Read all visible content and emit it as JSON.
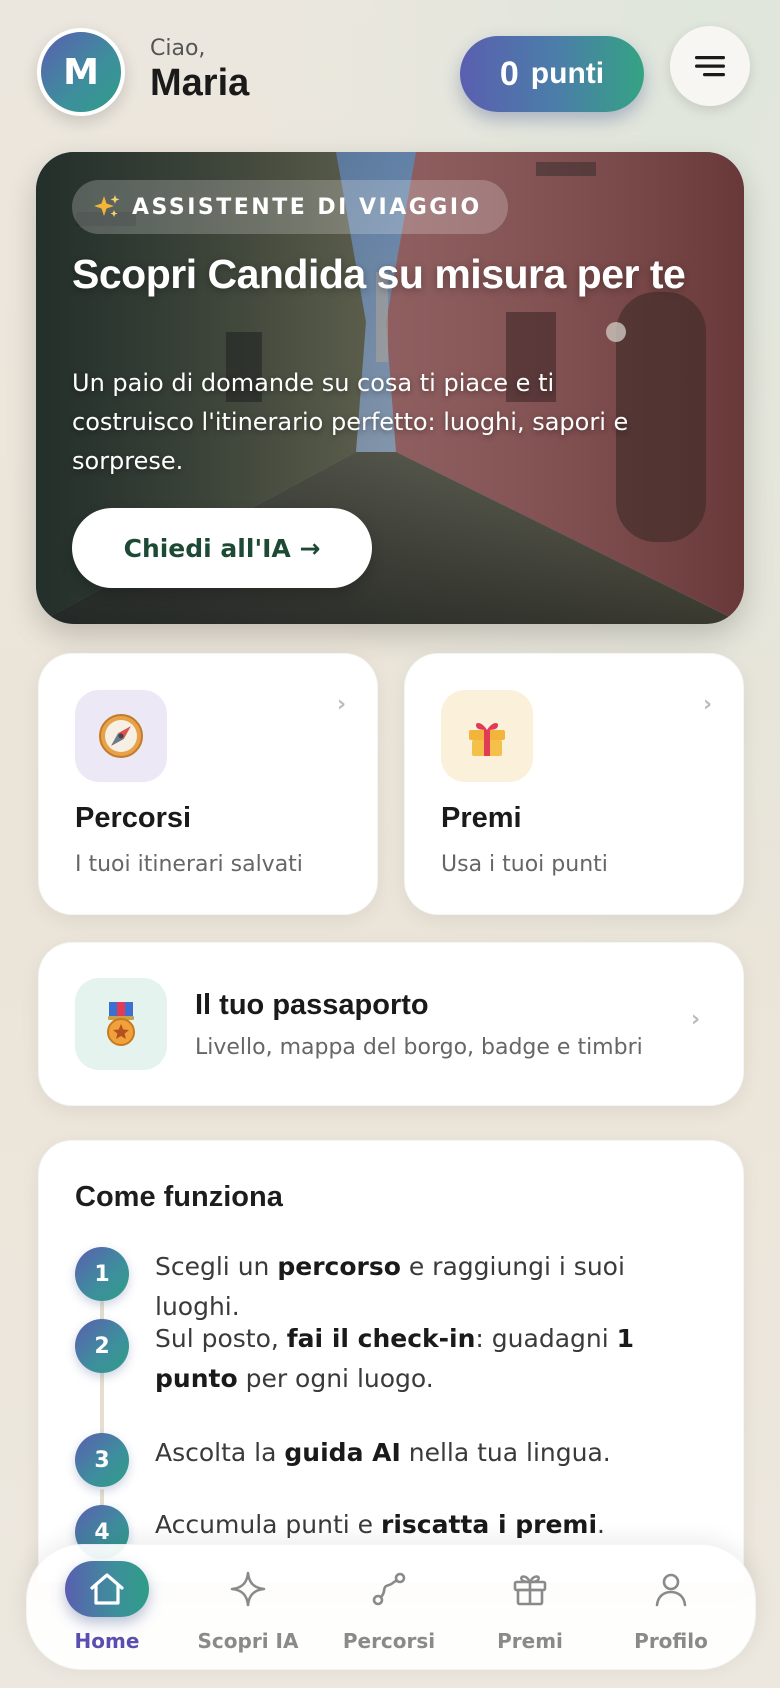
{
  "header": {
    "avatar_initial": "M",
    "greeting": "Ciao,",
    "user_name": "Maria",
    "points_value": "0",
    "points_label": "punti",
    "menu_icon": "hamburger-icon"
  },
  "hero": {
    "badge_icon": "sparkles-icon",
    "badge_label": "ASSISTENTE DI VIAGGIO",
    "title": "Scopri Candida su misura per te",
    "description": "Un paio di domande su cosa ti piace e ti costruisco l'itinerario perfetto: luoghi, sapori e sorprese.",
    "cta_label": "Chiedi all'IA →"
  },
  "cards": {
    "percorsi": {
      "icon": "compass-icon",
      "title": "Percorsi",
      "subtitle": "I tuoi itinerari salvati"
    },
    "premi": {
      "icon": "gift-icon",
      "title": "Premi",
      "subtitle": "Usa i tuoi punti"
    },
    "passaporto": {
      "icon": "medal-icon",
      "title": "Il tuo passaporto",
      "subtitle": "Livello, mappa del borgo, badge e timbri"
    }
  },
  "how_it_works": {
    "title": "Come funziona",
    "steps": [
      {
        "num": "1",
        "pre": "Scegli un ",
        "b1": "percorso",
        "mid": " e raggiungi i suoi luoghi.",
        "b2": "",
        "post": ""
      },
      {
        "num": "2",
        "pre": "Sul posto, ",
        "b1": "fai il check-in",
        "mid": ": guadagni ",
        "b2": "1 punto",
        "post": " per ogni luogo."
      },
      {
        "num": "3",
        "pre": "Ascolta la ",
        "b1": "guida AI",
        "mid": " nella tua lingua.",
        "b2": "",
        "post": ""
      },
      {
        "num": "4",
        "pre": "Accumula punti e ",
        "b1": "riscatta i premi",
        "mid": ".",
        "b2": "",
        "post": ""
      }
    ]
  },
  "nav": {
    "items": [
      {
        "label": "Home",
        "icon": "home-icon",
        "active": true
      },
      {
        "label": "Scopri IA",
        "icon": "sparkle-icon",
        "active": false
      },
      {
        "label": "Percorsi",
        "icon": "route-icon",
        "active": false
      },
      {
        "label": "Premi",
        "icon": "gift-icon",
        "active": false
      },
      {
        "label": "Profilo",
        "icon": "user-icon",
        "active": false
      }
    ]
  },
  "colors": {
    "brand_gradient_start": "#5a5fb0",
    "brand_gradient_end": "#2f9d86",
    "cta_text": "#1d4a35",
    "active_nav_label": "#5a4fb0"
  }
}
